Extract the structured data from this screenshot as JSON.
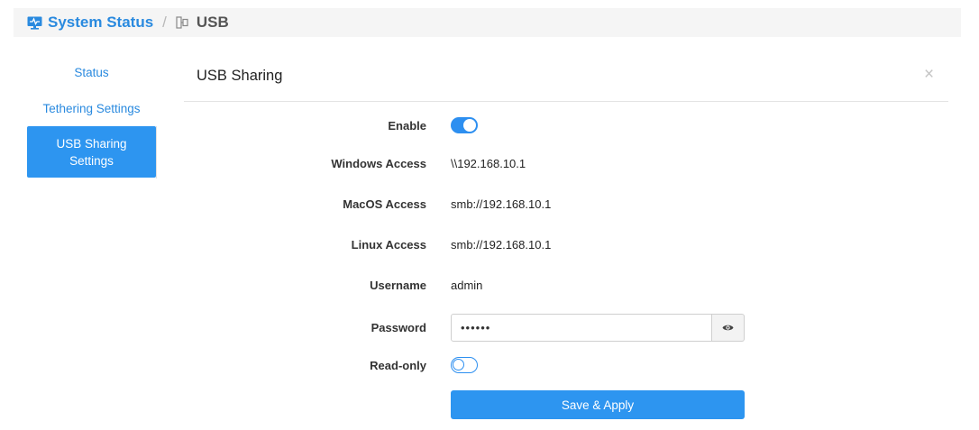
{
  "breadcrumb": {
    "home_label": "System Status",
    "separator": "/",
    "current_label": "USB",
    "home_icon": "monitor-icon",
    "current_icon": "usb-device-icon"
  },
  "sidebar": {
    "items": [
      {
        "label": "Status",
        "active": false
      },
      {
        "label": "Tethering Settings",
        "active": false
      },
      {
        "label": "USB Sharing Settings",
        "active": true
      }
    ]
  },
  "panel": {
    "title": "USB Sharing",
    "close_glyph": "×"
  },
  "form": {
    "enable": {
      "label": "Enable",
      "value": true
    },
    "windows_access": {
      "label": "Windows Access",
      "value": "\\\\192.168.10.1"
    },
    "macos_access": {
      "label": "MacOS Access",
      "value": "smb://192.168.10.1"
    },
    "linux_access": {
      "label": "Linux Access",
      "value": "smb://192.168.10.1"
    },
    "username": {
      "label": "Username",
      "value": "admin"
    },
    "password": {
      "label": "Password",
      "value": "••••••"
    },
    "read_only": {
      "label": "Read-only",
      "value": false
    },
    "save_label": "Save & Apply"
  },
  "colors": {
    "accent": "#2d95f0",
    "link": "#2a8adf"
  }
}
